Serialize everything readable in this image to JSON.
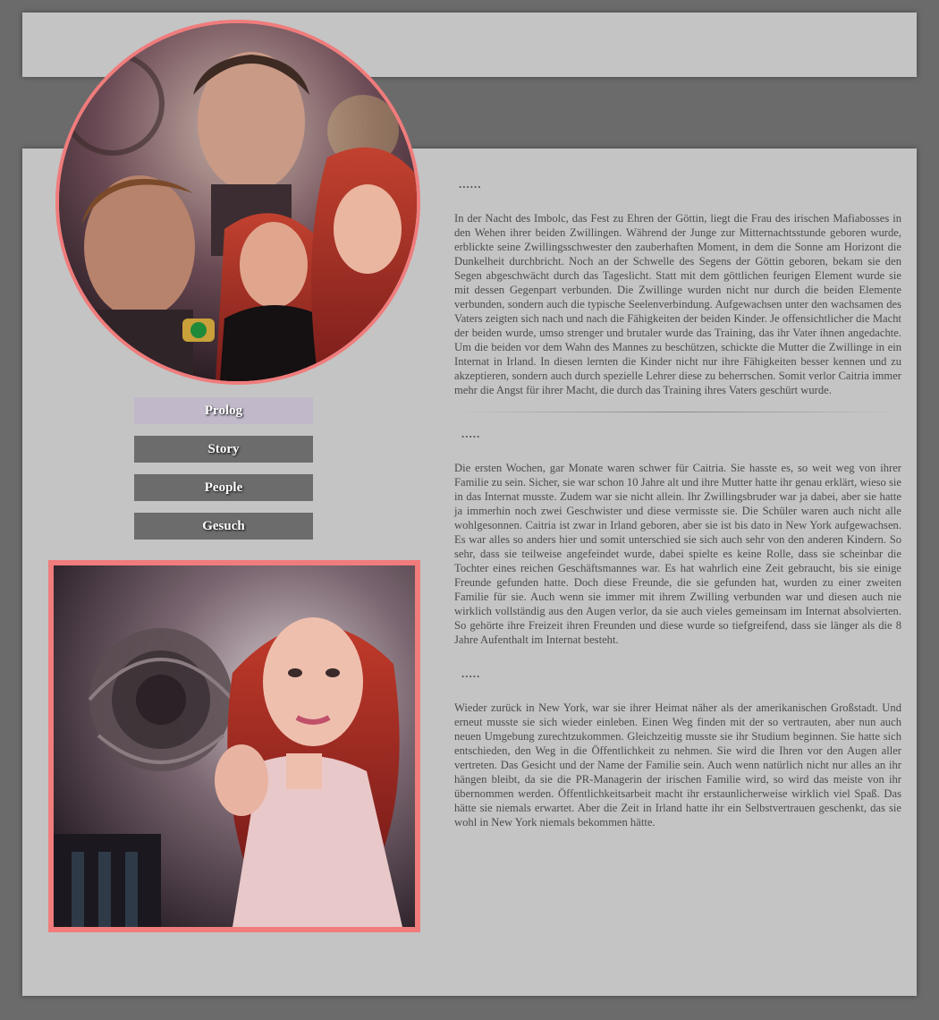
{
  "nav": {
    "items": [
      {
        "label": "Prolog",
        "active": true
      },
      {
        "label": "Story",
        "active": false
      },
      {
        "label": "People",
        "active": false
      },
      {
        "label": "Gesuch",
        "active": false
      }
    ]
  },
  "colors": {
    "page_bg": "#6b6b6b",
    "panel_bg": "#c4c4c4",
    "accent_border": "#f07c7c",
    "active_button": "#c1b9ca",
    "button": "#6c6c6c"
  },
  "images": {
    "portrait": "portrait-collage-image",
    "square": "redhead-rose-artwork-image"
  },
  "sections": [
    {
      "heading": "......",
      "text": "In der Nacht des Imbolc, das Fest zu Ehren der Göttin, liegt die Frau des irischen Mafiabosses in den Wehen ihrer beiden Zwillingen. Während der Junge zur Mitternachtsstunde geboren wurde, erblickte seine Zwillingsschwester den zauberhaften Moment, in dem die Sonne am Horizont die Dunkelheit durchbricht. Noch an der Schwelle des Segens der Göttin geboren, bekam sie den Segen abgeschwächt durch das Tageslicht. Statt mit dem göttlichen feurigen Element wurde sie mit dessen Gegenpart verbunden. Die Zwillinge wurden nicht nur durch die beiden Elemente verbunden, sondern auch die typische Seelenverbindung. Aufgewachsen unter den wachsamen des Vaters zeigten sich nach und nach die Fähigkeiten der beiden Kinder. Je offensichtlicher die Macht der beiden wurde, umso strenger und brutaler wurde das Training, das ihr Vater ihnen angedachte. Um die beiden vor dem Wahn des Mannes zu beschützen, schickte die Mutter die Zwillinge in ein Internat in Irland. In diesen lernten die Kinder nicht nur ihre Fähigkeiten besser kennen und zu akzeptieren, sondern auch durch spezielle Lehrer diese zu beherrschen. Somit verlor Caitria immer mehr die Angst für ihrer Macht, die durch das Training ihres Vaters geschürt wurde."
    },
    {
      "heading": ".....",
      "text": "Die ersten Wochen, gar Monate waren schwer für Caitria. Sie hasste es, so weit weg von ihrer Familie zu sein. Sicher, sie war schon 10 Jahre alt und ihre Mutter hatte ihr genau erklärt, wieso sie in das Internat musste. Zudem war sie nicht allein. Ihr Zwillingsbruder war ja dabei, aber sie hatte ja immerhin noch zwei Geschwister und diese vermisste sie. Die Schüler waren auch nicht alle wohlgesonnen. Caitria ist zwar in Irland geboren, aber sie ist bis dato in New York aufgewachsen. Es war alles so anders hier und somit unterschied sie sich auch sehr von den anderen Kindern. So sehr, dass sie teilweise angefeindet wurde, dabei spielte es keine Rolle, dass sie scheinbar die Tochter eines reichen Geschäftsmannes war. Es hat wahrlich eine Zeit gebraucht, bis sie einige Freunde gefunden hatte. Doch diese Freunde, die sie gefunden hat, wurden zu einer zweiten Familie für sie. Auch wenn sie immer mit ihrem Zwilling verbunden war und diesen auch nie wirklich vollständig aus den Augen verlor, da sie auch vieles gemeinsam im Internat absolvierten. So gehörte ihre Freizeit ihren Freunden und diese wurde so tiefgreifend, dass sie länger als die 8 Jahre Aufenthalt im Internat besteht."
    },
    {
      "heading": ".....",
      "text": "Wieder zurück in New York, war sie ihrer Heimat näher als der amerikanischen Großstadt. Und erneut musste sie sich wieder einleben. Einen Weg finden mit der so vertrauten, aber nun auch neuen Umgebung zurechtzukommen. Gleichzeitig musste sie ihr Studium beginnen. Sie hatte sich entschieden, den Weg in die Öffentlichkeit zu nehmen. Sie wird die Ihren vor den Augen aller vertreten. Das Gesicht und der Name der Familie sein. Auch wenn natürlich nicht nur alles an ihr hängen bleibt, da sie die PR-Managerin der irischen Familie wird, so wird das meiste von ihr übernommen werden. Öffentlichkeitsarbeit macht ihr erstaunlicherweise wirklich viel Spaß. Das hätte sie niemals erwartet. Aber die Zeit in Irland hatte ihr ein Selbstvertrauen geschenkt, das sie wohl in New York niemals bekommen hätte."
    }
  ]
}
